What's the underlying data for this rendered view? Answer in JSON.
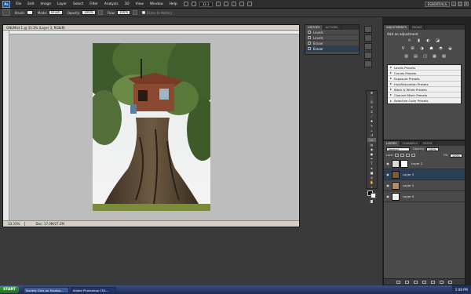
{
  "menubar": {
    "logo": "Ps",
    "items": [
      "File",
      "Edit",
      "Image",
      "Layer",
      "Select",
      "Filter",
      "Analysis",
      "3D",
      "View",
      "Window",
      "Help"
    ],
    "zoom": "33.3",
    "workspace": "ESSENTIALS"
  },
  "options": {
    "brush_label": "Brush:",
    "brush_value": "",
    "mode_label": "Mode:",
    "mode_value": "Brush",
    "opacity_label": "Opacity:",
    "opacity_value": "100%",
    "flow_label": "Flow:",
    "flow_value": "100%",
    "history_label": "Erase to History"
  },
  "document": {
    "title": "GNUMist 1 @ 33.3% (Layer 3, RGB/8)",
    "zoom": "33.33%",
    "doc_info": "Doc: 17.0M/27.2M"
  },
  "history": {
    "tabs": [
      "HISTORY",
      "ACTIONS"
    ],
    "items": [
      "Levels",
      "Levels",
      "Eraser",
      "Eraser"
    ],
    "selected": 3
  },
  "adjustments": {
    "tabs": [
      "ADJUSTMENTS",
      "MASKS"
    ],
    "hint": "Add an adjustment",
    "icons_row1": [
      "☼",
      "▮",
      "◐",
      "◪"
    ],
    "icons_row2": [
      "V",
      "⊞",
      "◑",
      "☗",
      "◓",
      "◒"
    ],
    "icons_row3": [
      "▥",
      "▤",
      "◫",
      "▦",
      "▧"
    ],
    "presets": [
      "Levels Presets",
      "Curves Presets",
      "Exposure Presets",
      "Hue/Saturation Presets",
      "Black & White Presets",
      "Channel Mixer Presets",
      "Selective Color Presets"
    ]
  },
  "layers": {
    "tabs": [
      "LAYERS",
      "CHANNELS",
      "PATHS"
    ],
    "blend": "Normal",
    "opacity_label": "Opacity:",
    "opacity": "100%",
    "lock_label": "Lock:",
    "fill_label": "Fill:",
    "fill": "100%",
    "items": [
      {
        "name": "Layer 2",
        "selected": false
      },
      {
        "name": "Layer 3",
        "selected": true
      },
      {
        "name": "Layer 1",
        "selected": false
      },
      {
        "name": "Layer 0",
        "selected": false
      }
    ]
  },
  "taskbar": {
    "start": "START",
    "tasks": [
      "Society Girls on Facebo...",
      "Adobe Photoshop CS4..."
    ],
    "clock": "5:08 PM"
  },
  "colors": {
    "accent": "#2a3e55",
    "workspace": "#3a3a3a",
    "panel": "#4a4a4a"
  }
}
